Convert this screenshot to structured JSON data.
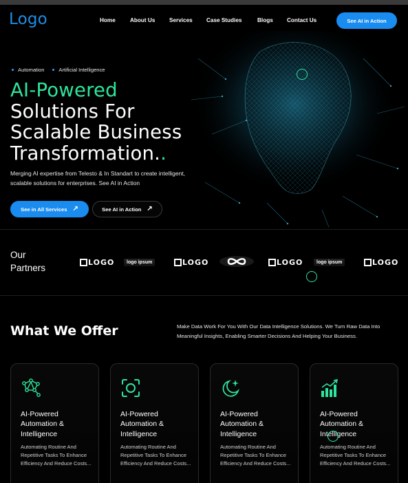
{
  "nav": {
    "logo": "Logo",
    "links": [
      "Home",
      "About Us",
      "Services",
      "Case Studies",
      "Blogs",
      "Contact Us"
    ],
    "cta": "See AI in Action"
  },
  "hero": {
    "tags": [
      "Automation",
      "Artificial Intelligence"
    ],
    "title_line1": "AI-Powered",
    "title_line2": "Solutions For",
    "title_line3": "Scalable Business",
    "title_line4": "Transformation.",
    "title_dot": ".",
    "description": "Merging AI expertise from Telesto & In Standart to create intelligent, scalable solutions for enterprises. See AI in Action",
    "primary_button": "See in All Services",
    "secondary_button": "See AI in Action"
  },
  "partners": {
    "title_line1": "Our",
    "title_line2": "Partners",
    "logos": [
      "LOGO",
      "logo ipsum",
      "LOGO",
      "infinity-logo",
      "LOGO",
      "logo ipsum",
      "LOGO"
    ]
  },
  "offer": {
    "title": "What We Offer",
    "description": "Make Data Work For You With Our Data Intelligence Solutions. We Turn Raw Data Into Meaningful Insights, Enabling Smarter Decisions And Helping Your Business.",
    "cards": [
      {
        "icon": "network-nodes-icon",
        "title": "AI-Powered Automation & Intelligence",
        "desc": "Automating Routine And Repetitive Tasks To Enhance Efficiency And Reduce Costs..."
      },
      {
        "icon": "scan-face-icon",
        "title": "AI-Powered Automation & Intelligence",
        "desc": "Automating Routine And Repetitive Tasks To Enhance Efficiency And Reduce Costs..."
      },
      {
        "icon": "moon-sparkle-icon",
        "title": "AI-Powered Automation & Intelligence",
        "desc": "Automating Routine And Repetitive Tasks To Enhance Efficiency And Reduce Costs..."
      },
      {
        "icon": "bar-chart-icon",
        "title": "AI-Powered Automation & Intelligence",
        "desc": "Automating Routine And Repetitive Tasks To Enhance Efficiency And Reduce Costs..."
      }
    ]
  },
  "colors": {
    "background": "#000000",
    "accent_blue": "#1a8cf0",
    "accent_green": "#2ee59d"
  }
}
